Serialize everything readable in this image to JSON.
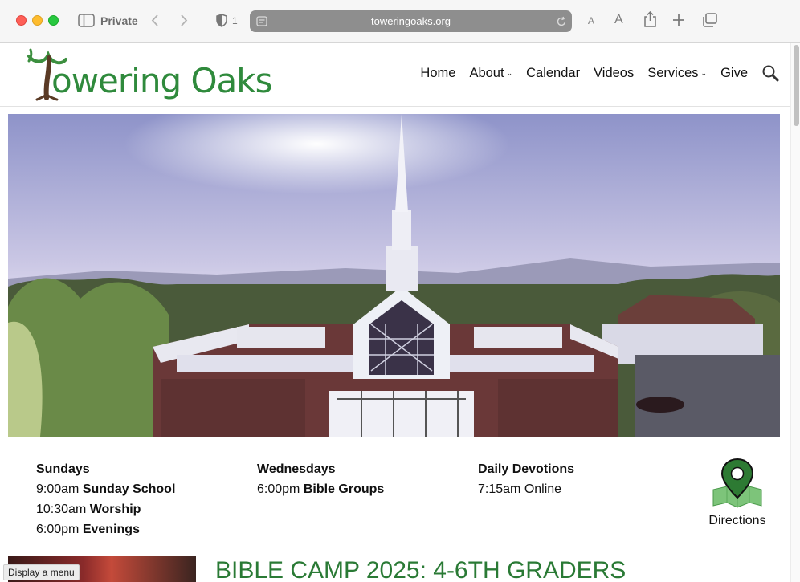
{
  "browser": {
    "private_label": "Private",
    "tab_count": "1",
    "url": "toweringoaks.org",
    "text_smaller": "A",
    "text_larger": "A"
  },
  "site": {
    "logo_text": "owering Oaks",
    "nav": [
      {
        "label": "Home",
        "has_dropdown": false
      },
      {
        "label": "About",
        "has_dropdown": true
      },
      {
        "label": "Calendar",
        "has_dropdown": false
      },
      {
        "label": "Videos",
        "has_dropdown": false
      },
      {
        "label": "Services",
        "has_dropdown": true
      },
      {
        "label": "Give",
        "has_dropdown": false
      }
    ],
    "brand_color": "#2f8a3c"
  },
  "schedule": {
    "sundays": {
      "title": "Sundays",
      "rows": [
        {
          "time": "9:00am",
          "event": "Sunday School"
        },
        {
          "time": "10:30am",
          "event": "Worship"
        },
        {
          "time": "6:00pm",
          "event": "Evenings"
        }
      ]
    },
    "wednesdays": {
      "title": "Wednesdays",
      "rows": [
        {
          "time": "6:00pm",
          "event": "Bible Groups"
        }
      ]
    },
    "devotions": {
      "title": "Daily Devotions",
      "time": "7:15am",
      "link": "Online"
    },
    "directions_label": "Directions"
  },
  "article": {
    "title": "BIBLE CAMP 2025: 4-6TH GRADERS"
  },
  "status_tooltip": "Display a menu"
}
